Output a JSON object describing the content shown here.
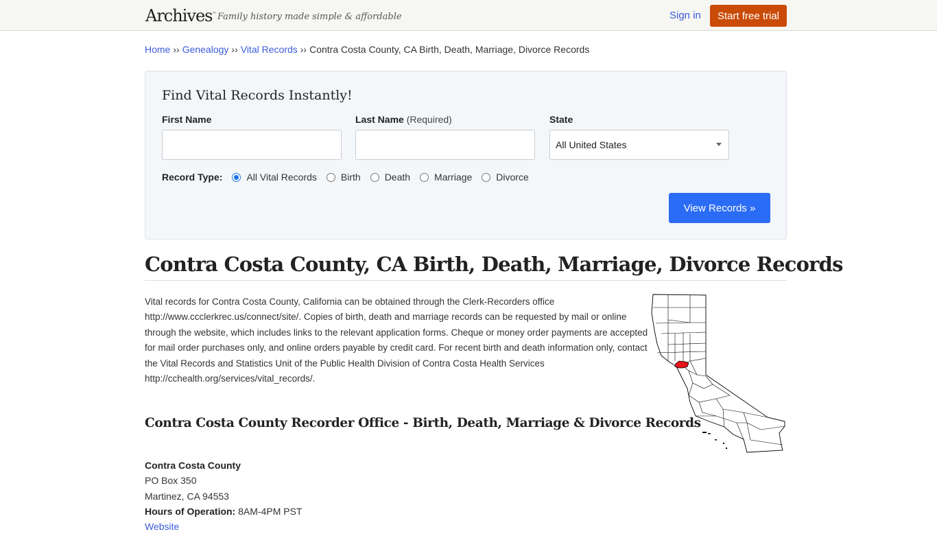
{
  "header": {
    "logo": "Archives",
    "logo_mark": "™",
    "tagline": "Family history made simple & affordable",
    "sign_in": "Sign in",
    "start_trial": "Start free trial"
  },
  "breadcrumb": {
    "items": [
      "Home",
      "Genealogy",
      "Vital Records"
    ],
    "separator": "››",
    "current": "Contra Costa County, CA Birth, Death, Marriage, Divorce Records"
  },
  "search": {
    "title": "Find Vital Records Instantly!",
    "first_name_label": "First Name",
    "first_name_value": "",
    "last_name_label": "Last Name",
    "last_name_required": "(Required)",
    "last_name_value": "",
    "state_label": "State",
    "state_selected": "All United States",
    "record_type_label": "Record Type:",
    "record_types": [
      {
        "label": "All Vital Records",
        "checked": true
      },
      {
        "label": "Birth",
        "checked": false
      },
      {
        "label": "Death",
        "checked": false
      },
      {
        "label": "Marriage",
        "checked": false
      },
      {
        "label": "Divorce",
        "checked": false
      }
    ],
    "submit": "View Records »"
  },
  "main": {
    "title": "Contra Costa County, CA Birth, Death, Marriage, Divorce Records",
    "intro": "Vital records for Contra Costa County, California can be obtained through the Clerk-Recorders office http://www.ccclerkrec.us/connect/site/. Copies of birth, death and marriage records can be requested by mail or online through the website, which includes links to the relevant application forms. Cheque or money order payments are accepted for mail order purchases only, and online orders payable by credit card. For recent birth and death information only, contact the Vital Records and Statistics Unit of the Public Health Division of Contra Costa Health Services http://cchealth.org/services/vital_records/.",
    "map_alt": "California county map with Contra Costa County highlighted",
    "map_highlight_color": "#e8141c",
    "office_heading": "Contra Costa County Recorder Office - Birth, Death, Marriage & Divorce Records",
    "office": {
      "name": "Contra Costa County",
      "address1": "PO Box 350",
      "address2": "Martinez, CA 94553",
      "hours_label": "Hours of Operation:",
      "hours": "8AM-4PM PST",
      "website_link": "Website"
    }
  },
  "colors": {
    "trial_button": "#c94b07",
    "primary_button": "#2b6cf6",
    "link": "#3b5bdb"
  }
}
